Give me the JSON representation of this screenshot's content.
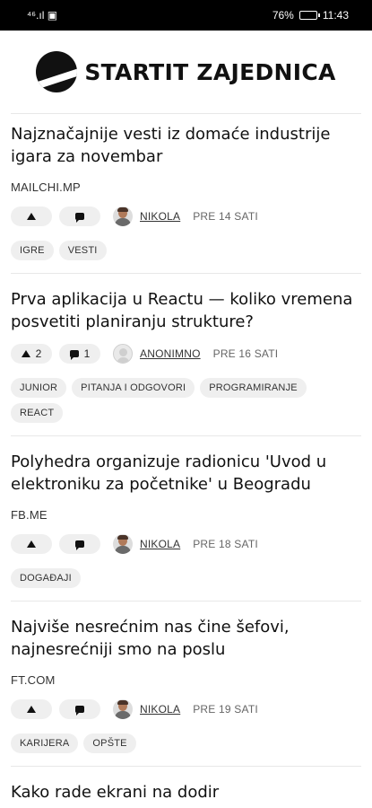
{
  "status": {
    "left": "⁴⁶.ıl ▣",
    "battery": "76%",
    "battery_level": 0.76,
    "time": "11:43"
  },
  "app": {
    "title": "STARTIT ZAJEDNICA"
  },
  "posts": [
    {
      "title": "Najznačajnije vesti iz domaće industrije igara za novembar",
      "source": "MAILCHI.MP",
      "votes": "",
      "comments": "",
      "author": "NIKOLA",
      "avatar": "photo",
      "time": "PRE 14 SATI",
      "tags": [
        "IGRE",
        "VESTI"
      ]
    },
    {
      "title": "Prva aplikacija u Reactu — koliko vremena posvetiti planiranju strukture?",
      "source": "",
      "votes": "2",
      "comments": "1",
      "author": "ANONIMNO",
      "avatar": "anon",
      "time": "PRE 16 SATI",
      "tags": [
        "JUNIOR",
        "PITANJA I ODGOVORI",
        "PROGRAMIRANJE",
        "REACT"
      ]
    },
    {
      "title": "Polyhedra organizuje radionicu 'Uvod u elektroniku za početnike' u Beogradu",
      "source": "FB.ME",
      "votes": "",
      "comments": "",
      "author": "NIKOLA",
      "avatar": "photo",
      "time": "PRE 18 SATI",
      "tags": [
        "DOGAĐAJI"
      ]
    },
    {
      "title": "Najviše nesrećnim nas čine šefovi, najnesrećniji smo na poslu",
      "source": "FT.COM",
      "votes": "",
      "comments": "",
      "author": "NIKOLA",
      "avatar": "photo",
      "time": "PRE 19 SATI",
      "tags": [
        "KARIJERA",
        "OPŠTE"
      ]
    },
    {
      "title": "Kako rade ekrani na dodir",
      "source": "",
      "votes": "",
      "comments": "",
      "author": "",
      "avatar": "",
      "time": "",
      "tags": []
    }
  ]
}
